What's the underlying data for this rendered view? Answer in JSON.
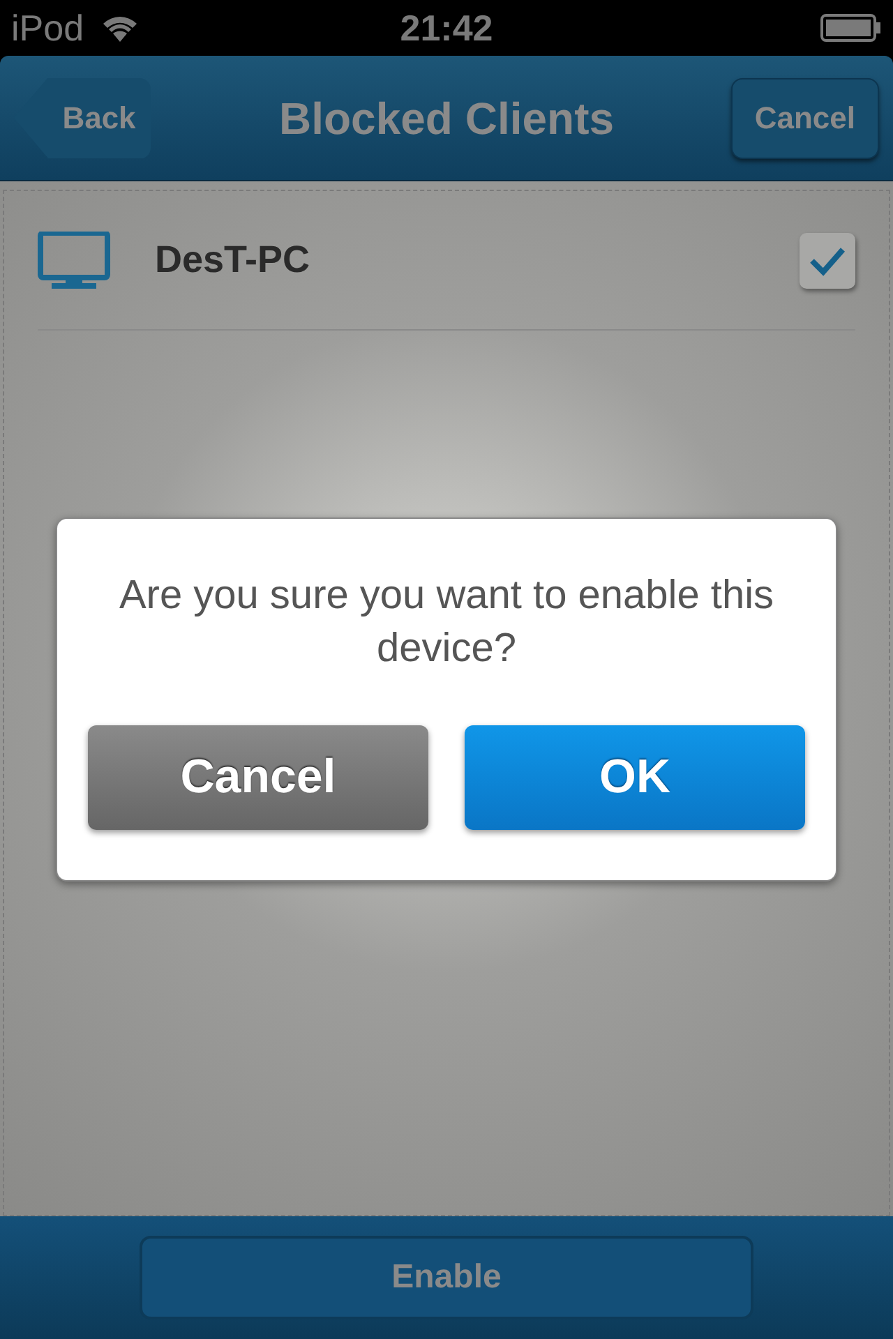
{
  "status_bar": {
    "carrier": "iPod",
    "time": "21:42"
  },
  "nav_bar": {
    "back": "Back",
    "title": "Blocked Clients",
    "action": "Cancel"
  },
  "clients": [
    {
      "name": "DesT-PC",
      "checked": true
    }
  ],
  "dialog": {
    "message": "Are you sure you want to enable this device?",
    "buttons": [
      {
        "label": "Cancel",
        "kind": "secondary"
      },
      {
        "label": "OK",
        "kind": "primary"
      }
    ]
  },
  "toolbar": {
    "button": "Enable"
  }
}
